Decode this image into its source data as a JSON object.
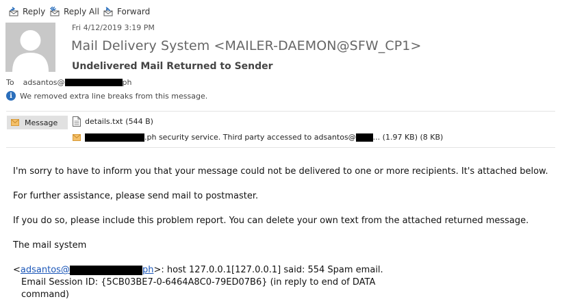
{
  "toolbar": {
    "reply": "Reply",
    "reply_all": "Reply All",
    "forward": "Forward"
  },
  "header": {
    "date": "Fri 4/12/2019 3:19 PM",
    "from": "Mail Delivery System <MAILER-DAEMON@SFW_CP1>",
    "subject": "Undelivered Mail Returned to Sender",
    "to_label": "To",
    "to_prefix": "adsantos@",
    "to_suffix": "ph",
    "info": "We removed extra line breaks from this message."
  },
  "attachments": {
    "message_tab": "Message",
    "file1_name": "details.txt",
    "file1_size": "(544 B)",
    "file2_text": ".ph security service. Third party accessed to adsantos@",
    "file2_tail": "... (1.97 KB) (8 KB)"
  },
  "body": {
    "p1": "I'm sorry to have to inform you that your message could not be delivered to one or more recipients. It's attached below.",
    "p2": "For further assistance, please send mail to postmaster.",
    "p3": "If you do so, please include this problem report. You can delete your own text from the attached returned message.",
    "p4": "The mail system",
    "lt": "<",
    "link_prefix": "adsantos@",
    "link_suffix": "ph",
    "report_rest": ">: host 127.0.0.1[127.0.0.1] said: 554 Spam email.",
    "report_line2": "Email Session ID: {5CB03BE7-0-6464A8C0-79ED07B6} (in reply to end of DATA",
    "report_line3": "command)"
  },
  "colors": {
    "link": "#1a56b8",
    "info_icon": "#2a6ebb",
    "envelope": "#e8a33a"
  }
}
